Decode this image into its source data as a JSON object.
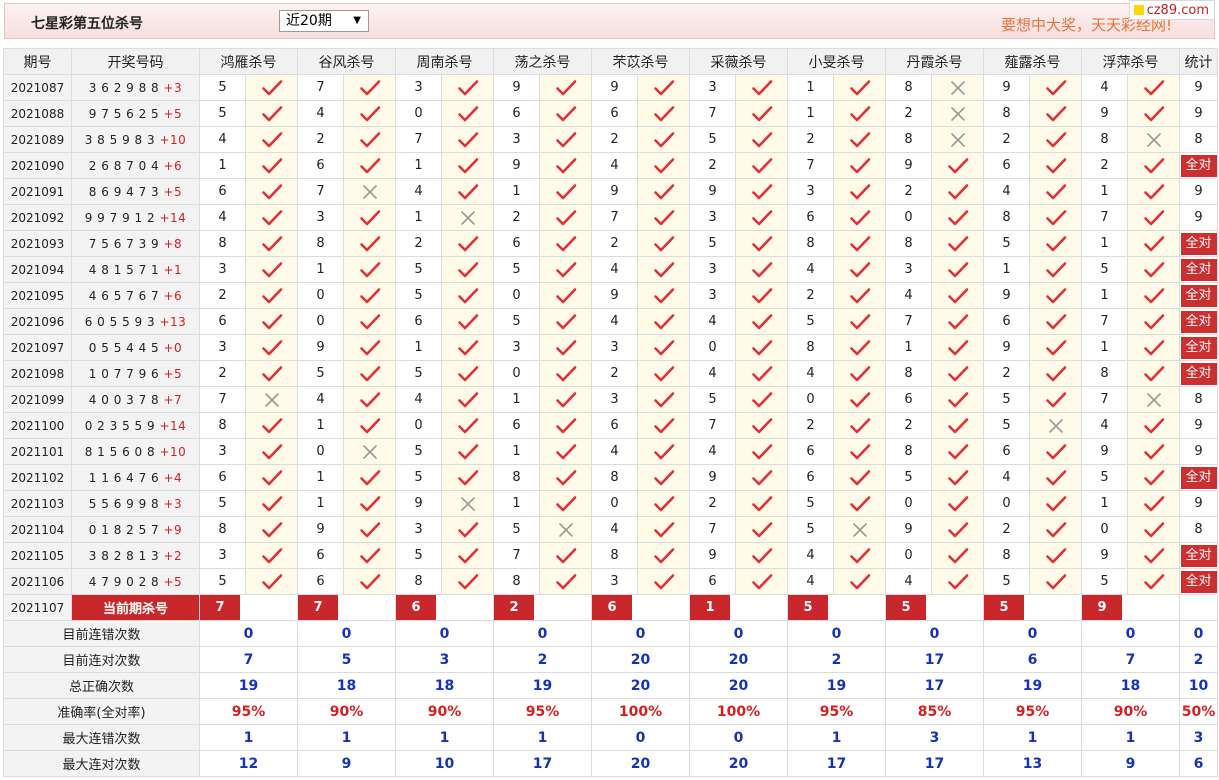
{
  "header": {
    "title": "七星彩第五位杀号",
    "select_value": "近20期",
    "select_arrow": "▼",
    "marquee": "要想中大奖，天天彩经网!",
    "site_badge": "cz89.com"
  },
  "columns": {
    "period": "期号",
    "draw": "开奖号码",
    "experts": [
      "鸿雁杀号",
      "谷风杀号",
      "周南杀号",
      "荡之杀号",
      "芣苡杀号",
      "采薇杀号",
      "小旻杀号",
      "丹霞杀号",
      "薤露杀号",
      "浮萍杀号"
    ],
    "stat": "统计"
  },
  "rows": [
    {
      "period": "2021087",
      "draw": "3 6 2 9 8 8 ",
      "plus": "+3",
      "kills": [
        5,
        7,
        3,
        9,
        9,
        3,
        1,
        8,
        9,
        4
      ],
      "results": [
        "y",
        "y",
        "y",
        "y",
        "y",
        "y",
        "y",
        "n",
        "y",
        "y"
      ],
      "stat": "9"
    },
    {
      "period": "2021088",
      "draw": "9 7 5 6 2 5 ",
      "plus": "+5",
      "kills": [
        5,
        4,
        0,
        6,
        6,
        7,
        1,
        2,
        8,
        9
      ],
      "results": [
        "y",
        "y",
        "y",
        "y",
        "y",
        "y",
        "y",
        "n",
        "y",
        "y"
      ],
      "stat": "9"
    },
    {
      "period": "2021089",
      "draw": "3 8 5 9 8 3 ",
      "plus": "+10",
      "kills": [
        4,
        2,
        7,
        3,
        2,
        5,
        2,
        8,
        2,
        8
      ],
      "results": [
        "y",
        "y",
        "y",
        "y",
        "y",
        "y",
        "y",
        "n",
        "y",
        "n"
      ],
      "stat": "8"
    },
    {
      "period": "2021090",
      "draw": "2 6 8 7 0 4 ",
      "plus": "+6",
      "kills": [
        1,
        6,
        1,
        9,
        4,
        2,
        7,
        9,
        6,
        2
      ],
      "results": [
        "y",
        "y",
        "y",
        "y",
        "y",
        "y",
        "y",
        "y",
        "y",
        "y"
      ],
      "stat": "全对"
    },
    {
      "period": "2021091",
      "draw": "8 6 9 4 7 3 ",
      "plus": "+5",
      "kills": [
        6,
        7,
        4,
        1,
        9,
        9,
        3,
        2,
        4,
        1
      ],
      "results": [
        "y",
        "n",
        "y",
        "y",
        "y",
        "y",
        "y",
        "y",
        "y",
        "y"
      ],
      "stat": "9"
    },
    {
      "period": "2021092",
      "draw": "9 9 7 9 1 2 ",
      "plus": "+14",
      "kills": [
        4,
        3,
        1,
        2,
        7,
        3,
        6,
        0,
        8,
        7
      ],
      "results": [
        "y",
        "y",
        "n",
        "y",
        "y",
        "y",
        "y",
        "y",
        "y",
        "y"
      ],
      "stat": "9"
    },
    {
      "period": "2021093",
      "draw": "7 5 6 7 3 9 ",
      "plus": "+8",
      "kills": [
        8,
        8,
        2,
        6,
        2,
        5,
        8,
        8,
        5,
        1
      ],
      "results": [
        "y",
        "y",
        "y",
        "y",
        "y",
        "y",
        "y",
        "y",
        "y",
        "y"
      ],
      "stat": "全对"
    },
    {
      "period": "2021094",
      "draw": "4 8 1 5 7 1 ",
      "plus": "+1",
      "kills": [
        3,
        1,
        5,
        5,
        4,
        3,
        4,
        3,
        1,
        5
      ],
      "results": [
        "y",
        "y",
        "y",
        "y",
        "y",
        "y",
        "y",
        "y",
        "y",
        "y"
      ],
      "stat": "全对"
    },
    {
      "period": "2021095",
      "draw": "4 6 5 7 6 7 ",
      "plus": "+6",
      "kills": [
        2,
        0,
        5,
        0,
        9,
        3,
        2,
        4,
        9,
        1
      ],
      "results": [
        "y",
        "y",
        "y",
        "y",
        "y",
        "y",
        "y",
        "y",
        "y",
        "y"
      ],
      "stat": "全对"
    },
    {
      "period": "2021096",
      "draw": "6 0 5 5 9 3 ",
      "plus": "+13",
      "kills": [
        6,
        0,
        6,
        5,
        4,
        4,
        5,
        7,
        6,
        7
      ],
      "results": [
        "y",
        "y",
        "y",
        "y",
        "y",
        "y",
        "y",
        "y",
        "y",
        "y"
      ],
      "stat": "全对"
    },
    {
      "period": "2021097",
      "draw": "0 5 5 4 4 5 ",
      "plus": "+0",
      "kills": [
        3,
        9,
        1,
        3,
        3,
        0,
        8,
        1,
        9,
        1
      ],
      "results": [
        "y",
        "y",
        "y",
        "y",
        "y",
        "y",
        "y",
        "y",
        "y",
        "y"
      ],
      "stat": "全对"
    },
    {
      "period": "2021098",
      "draw": "1 0 7 7 9 6 ",
      "plus": "+5",
      "kills": [
        2,
        5,
        5,
        0,
        2,
        4,
        4,
        8,
        2,
        8
      ],
      "results": [
        "y",
        "y",
        "y",
        "y",
        "y",
        "y",
        "y",
        "y",
        "y",
        "y"
      ],
      "stat": "全对"
    },
    {
      "period": "2021099",
      "draw": "4 0 0 3 7 8 ",
      "plus": "+7",
      "kills": [
        7,
        4,
        4,
        1,
        3,
        5,
        0,
        6,
        5,
        7
      ],
      "results": [
        "n",
        "y",
        "y",
        "y",
        "y",
        "y",
        "y",
        "y",
        "y",
        "n"
      ],
      "stat": "8"
    },
    {
      "period": "2021100",
      "draw": "0 2 3 5 5 9 ",
      "plus": "+14",
      "kills": [
        8,
        1,
        0,
        6,
        6,
        7,
        2,
        2,
        5,
        4
      ],
      "results": [
        "y",
        "y",
        "y",
        "y",
        "y",
        "y",
        "y",
        "y",
        "n",
        "y"
      ],
      "stat": "9"
    },
    {
      "period": "2021101",
      "draw": "8 1 5 6 0 8 ",
      "plus": "+10",
      "kills": [
        3,
        0,
        5,
        1,
        4,
        4,
        6,
        8,
        6,
        9
      ],
      "results": [
        "y",
        "n",
        "y",
        "y",
        "y",
        "y",
        "y",
        "y",
        "y",
        "y"
      ],
      "stat": "9"
    },
    {
      "period": "2021102",
      "draw": "1 1 6 4 7 6 ",
      "plus": "+4",
      "kills": [
        6,
        1,
        5,
        8,
        8,
        9,
        6,
        5,
        4,
        5
      ],
      "results": [
        "y",
        "y",
        "y",
        "y",
        "y",
        "y",
        "y",
        "y",
        "y",
        "y"
      ],
      "stat": "全对"
    },
    {
      "period": "2021103",
      "draw": "5 5 6 9 9 8 ",
      "plus": "+3",
      "kills": [
        5,
        1,
        9,
        1,
        0,
        2,
        5,
        0,
        0,
        1
      ],
      "results": [
        "y",
        "y",
        "n",
        "y",
        "y",
        "y",
        "y",
        "y",
        "y",
        "y"
      ],
      "stat": "9"
    },
    {
      "period": "2021104",
      "draw": "0 1 8 2 5 7 ",
      "plus": "+9",
      "kills": [
        8,
        9,
        3,
        5,
        4,
        7,
        5,
        9,
        2,
        0
      ],
      "results": [
        "y",
        "y",
        "y",
        "n",
        "y",
        "y",
        "n",
        "y",
        "y",
        "y"
      ],
      "stat": "8"
    },
    {
      "period": "2021105",
      "draw": "3 8 2 8 1 3 ",
      "plus": "+2",
      "kills": [
        3,
        6,
        5,
        7,
        8,
        9,
        4,
        0,
        8,
        9
      ],
      "results": [
        "y",
        "y",
        "y",
        "y",
        "y",
        "y",
        "y",
        "y",
        "y",
        "y"
      ],
      "stat": "全对"
    },
    {
      "period": "2021106",
      "draw": "4 7 9 0 2 8 ",
      "plus": "+5",
      "kills": [
        5,
        6,
        8,
        8,
        3,
        6,
        4,
        4,
        5,
        5
      ],
      "results": [
        "y",
        "y",
        "y",
        "y",
        "y",
        "y",
        "y",
        "y",
        "y",
        "y"
      ],
      "stat": "全对"
    }
  ],
  "current": {
    "period": "2021107",
    "label": "当前期杀号",
    "kills": [
      "7",
      "7",
      "6",
      "2",
      "6",
      "1",
      "5",
      "5",
      "5",
      "9"
    ]
  },
  "summary": [
    {
      "label": "目前连错次数",
      "values": [
        "0",
        "0",
        "0",
        "0",
        "0",
        "0",
        "0",
        "0",
        "0",
        "0"
      ],
      "stat": "0"
    },
    {
      "label": "目前连对次数",
      "values": [
        "7",
        "5",
        "3",
        "2",
        "20",
        "20",
        "2",
        "17",
        "6",
        "7"
      ],
      "stat": "2"
    },
    {
      "label": "总正确次数",
      "values": [
        "19",
        "18",
        "18",
        "19",
        "20",
        "20",
        "19",
        "17",
        "19",
        "18"
      ],
      "stat": "10"
    },
    {
      "label": "准确率(全对率)",
      "values": [
        "95%",
        "90%",
        "90%",
        "95%",
        "100%",
        "100%",
        "95%",
        "85%",
        "95%",
        "90%"
      ],
      "stat": "50%",
      "rate": true
    },
    {
      "label": "最大连错次数",
      "values": [
        "1",
        "1",
        "1",
        "1",
        "0",
        "0",
        "1",
        "3",
        "1",
        "1"
      ],
      "stat": "3"
    },
    {
      "label": "最大连对次数",
      "values": [
        "12",
        "9",
        "10",
        "17",
        "20",
        "20",
        "17",
        "17",
        "13",
        "9"
      ],
      "stat": "6"
    }
  ],
  "colors": {
    "check": "#e0303a",
    "cross": "#9a9a9a",
    "accent": "#c8282b",
    "summary_blue": "#1533b9"
  }
}
